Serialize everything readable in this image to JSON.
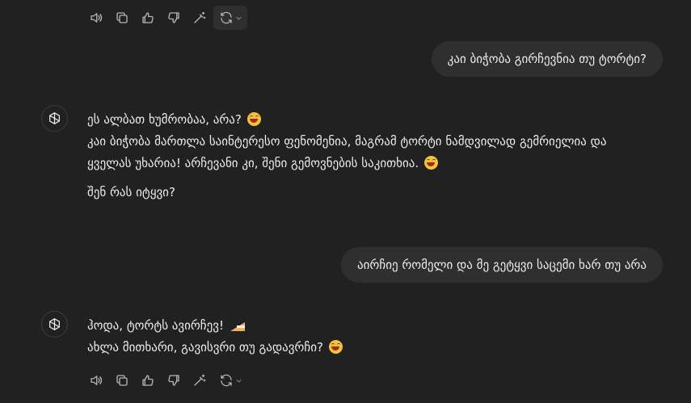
{
  "messages": {
    "user1": "კაი ბიჭობა გირჩევნია თუ ტორტი?",
    "assistant1": {
      "line1": "ეს ალბათ ხუმრობაა, არა?",
      "line2": "კაი ბიჭობა მართლა საინტერესო ფენომენია, მაგრამ ტორტი ნამდვილად გემრიელია და",
      "line3": "ყველას უხარია! არჩევანი კი, შენი გემოვნების საკითხია.",
      "line4": "შენ რას იტყვი?"
    },
    "user2": "აირჩიე რომელი და მე გეტყვი საცემი ხარ თუ არა",
    "assistant2": {
      "line1": "ჰოდა, ტორტს ავირჩევ!",
      "line2": "ახლა მითხარი, გავისვრი თუ გადავრჩი?"
    }
  },
  "icons": {
    "read_aloud": "speaker-icon",
    "copy": "copy-icon",
    "like": "thumbs-up-icon",
    "dislike": "thumbs-down-icon",
    "edit": "magic-wand-icon",
    "regenerate": "refresh-icon",
    "avatar": "openai-logo-icon",
    "emoji_grin": "grinning-face-emoji",
    "emoji_cake": "cake-slice-emoji"
  },
  "colors": {
    "background": "#212121",
    "bubble": "#2f2f2f",
    "text": "#ececec",
    "icon": "#b4b4b4"
  }
}
